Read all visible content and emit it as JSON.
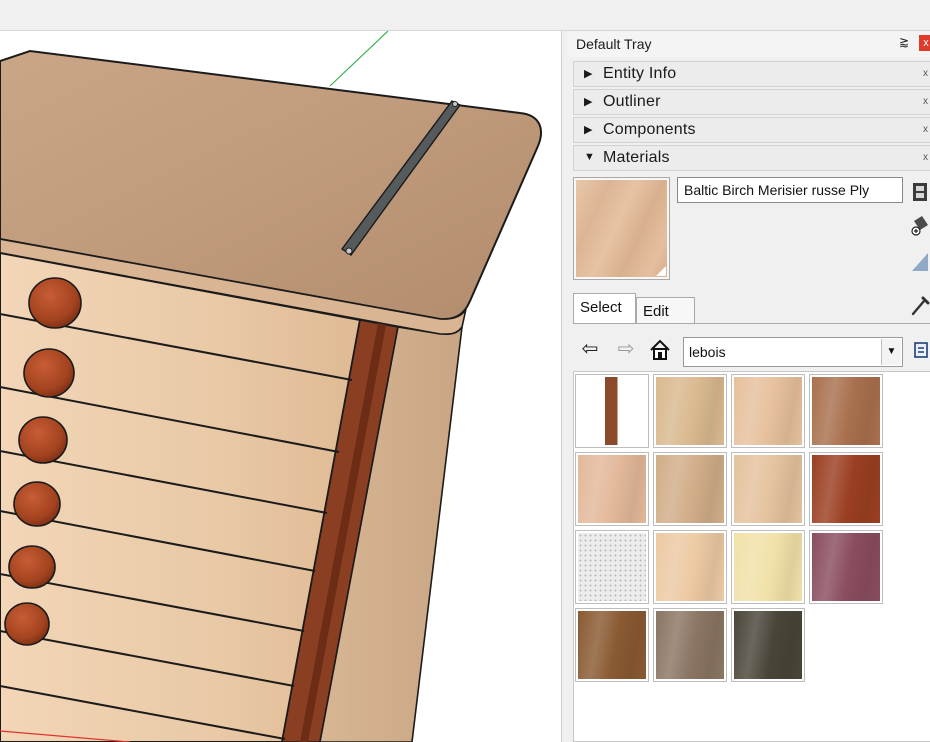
{
  "tray": {
    "title": "Default Tray",
    "pin_glyph": "⪆",
    "close_glyph": "x"
  },
  "sections": [
    {
      "label": "Entity Info",
      "expanded": false,
      "arrow": "▶",
      "close": "x"
    },
    {
      "label": "Outliner",
      "expanded": false,
      "arrow": "▶",
      "close": "x"
    },
    {
      "label": "Components",
      "expanded": false,
      "arrow": "▶",
      "close": "x"
    },
    {
      "label": "Materials",
      "expanded": true,
      "arrow": "▼",
      "close": "x"
    }
  ],
  "materials": {
    "current_name": "Baltic Birch Merisier russe Ply",
    "tabs": [
      {
        "label": "Select",
        "active": true
      },
      {
        "label": "Edit",
        "active": false
      }
    ],
    "nav": {
      "back_glyph": "⇦",
      "forward_glyph": "⇨",
      "home_glyph": "⌂"
    },
    "library": "lebois",
    "dropdown_glyph": "▼",
    "swatches": [
      {
        "name": "walnut-strip",
        "color": "#8b4a2a"
      },
      {
        "name": "light-oak",
        "color": "#d9b98f"
      },
      {
        "name": "birch",
        "color": "#e6c09c"
      },
      {
        "name": "walnut",
        "color": "#a9704e"
      },
      {
        "name": "pine-pink",
        "color": "#e3b89a"
      },
      {
        "name": "ash",
        "color": "#d1ad88"
      },
      {
        "name": "maple",
        "color": "#e4c29d"
      },
      {
        "name": "mahogany",
        "color": "#9b3f22"
      },
      {
        "name": "perforated",
        "color": "#ececec"
      },
      {
        "name": "beech",
        "color": "#ecc9a3"
      },
      {
        "name": "basswood",
        "color": "#f1e1a8"
      },
      {
        "name": "purpleheart",
        "color": "#8a4d5e"
      },
      {
        "name": "teak",
        "color": "#8a5a32"
      },
      {
        "name": "grey-oak",
        "color": "#8b7563"
      },
      {
        "name": "wenge",
        "color": "#4a4539"
      }
    ]
  }
}
